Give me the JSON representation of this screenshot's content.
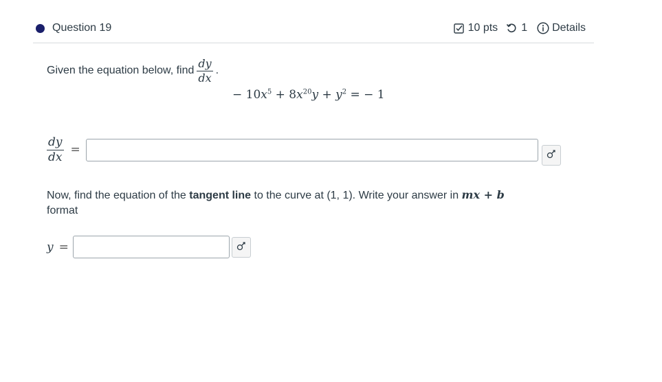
{
  "question": {
    "title": "Question 19",
    "points": "10 pts",
    "attempts": "1",
    "details_label": "Details"
  },
  "prompt": {
    "text": "Given the equation below, find",
    "deriv_num": "dy",
    "deriv_den": "dx",
    "period": "."
  },
  "equation": {
    "neg": "− 10",
    "x1": "x",
    "exp1": "5",
    "plus1": " + 8",
    "x2": "x",
    "exp2": "20",
    "y1": "y",
    "plus2": " + ",
    "y2": "y",
    "exp3": "2",
    "rhs": " = − 1"
  },
  "answer1": {
    "lhs_num": "dy",
    "lhs_den": "dx",
    "equals": "=",
    "value": ""
  },
  "tangent": {
    "part1": "Now, find the equation of the ",
    "bold": "tangent line",
    "part2": " to the curve at (1, 1). Write your answer in ",
    "formula": "mx + b",
    "part3": " format"
  },
  "answer2": {
    "lhs": "y",
    "equals": "=",
    "value": ""
  },
  "icons": {
    "points": "checkbox-icon",
    "attempts": "retry-icon",
    "details": "info-icon",
    "keyboard": "math-keyboard-icon"
  },
  "colors": {
    "bullet": "#1a1f6b",
    "text": "#2d3b45"
  }
}
